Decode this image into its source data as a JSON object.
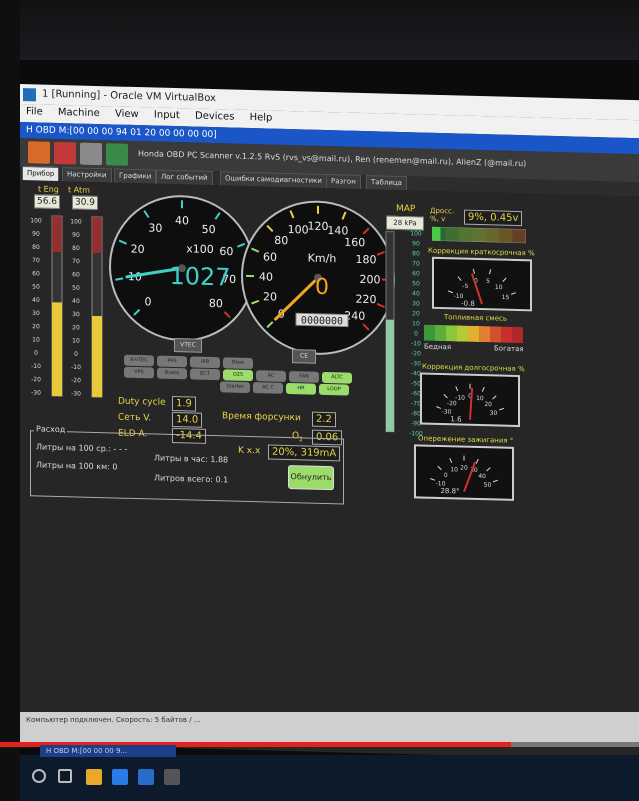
{
  "vm": {
    "title": "1 [Running] - Oracle VM VirtualBox",
    "menu": [
      "File",
      "Machine",
      "View",
      "Input",
      "Devices",
      "Help"
    ],
    "guest_window_title": "H OBD M:[00 00 00 94 01 20 00 00 00 00]"
  },
  "app": {
    "title": "Honda OBD PC Scanner v.1.2.5  RvS (rvs_vs@mail.ru), Ren (renemen@mail.ru), AlienZ (@mail.ru)",
    "tabs": [
      "Прибор",
      "Настройки",
      "Графики",
      "Лог событий",
      "Ошибки самодиагностики",
      "Разгон",
      "Таблица"
    ],
    "active_tab": 0
  },
  "bars": {
    "eng_label": "t Eng",
    "atm_label": "t Atm",
    "eng_value": "56.6",
    "atm_value": "30.9",
    "ticks": [
      "100",
      "90",
      "80",
      "70",
      "60",
      "50",
      "40",
      "30",
      "20",
      "10",
      "0",
      "-10",
      "-20",
      "-30"
    ],
    "eng_level": 0.52,
    "atm_level": 0.45
  },
  "tach": {
    "unit": "x100",
    "value": "1027",
    "ticks": [
      "0",
      "10",
      "20",
      "30",
      "40",
      "50",
      "60",
      "70",
      "80"
    ],
    "needle_value": 10.27,
    "max": 80,
    "gear_box": "VTEC"
  },
  "speedo": {
    "unit": "Km/h",
    "value": "0",
    "ticks": [
      "0",
      "20",
      "40",
      "60",
      "80",
      "100",
      "120",
      "140",
      "160",
      "180",
      "200",
      "220",
      "240"
    ],
    "odometer": "0000000",
    "needle_value": 0,
    "max": 240,
    "box": "CE"
  },
  "indicators": {
    "items": [
      {
        "label": "K-VTEC",
        "on": false
      },
      {
        "label": "PAS",
        "on": false
      },
      {
        "label": "IAB",
        "on": false
      },
      {
        "label": "Blow",
        "on": false
      },
      {
        "label": "VPS",
        "on": false
      },
      {
        "label": "Brake",
        "on": false
      },
      {
        "label": "ECT",
        "on": false
      },
      {
        "label": "O2S",
        "on": true
      },
      {
        "label": "AC",
        "on": false
      },
      {
        "label": "FAN",
        "on": false
      },
      {
        "label": "ALTC",
        "on": true
      },
      {
        "label": "Starter",
        "on": false
      },
      {
        "label": "AC C",
        "on": false
      },
      {
        "label": "HR",
        "on": true
      },
      {
        "label": "LOOP",
        "on": true
      }
    ]
  },
  "readouts": {
    "duty_cycle_label": "Duty cycle",
    "duty_cycle": "1.9",
    "set_v_label": "Сеть V.",
    "set_v": "14.0",
    "eld_label": "ELD  A.",
    "eld": "-14.4",
    "injector_label": "Время  форсунки",
    "injector": "2.2",
    "o2_label": "O",
    "o2_sub": "2",
    "o2": "0.06",
    "kxx_label": "K x.x",
    "kxx": "20%, 319mA"
  },
  "consumption": {
    "title": "Расход",
    "l100_avg": "Литры на 100 ср.: - - -",
    "l100_km": "Литры на 100 км: 0",
    "l_hour": "Литры в час: 1.88",
    "l_total": "Литров всего: 0.1",
    "reset": "Обнулить"
  },
  "map": {
    "label": "MAP",
    "value": "28 kPa",
    "ticks": [
      "100",
      "90",
      "80",
      "70",
      "60",
      "50",
      "40",
      "30",
      "20",
      "10",
      "0",
      "-10",
      "-20",
      "-30",
      "-40",
      "-50",
      "-60",
      "-70",
      "-80",
      "-90",
      "-100"
    ],
    "level": 0.12
  },
  "throttle": {
    "label": "Дросс.",
    "sub": "%, v",
    "value": "9%, 0.45v",
    "level": 0.09
  },
  "short_trim": {
    "title": "Коррекция краткосрочная %",
    "ticks": [
      "-10",
      "-5",
      "0",
      "5",
      "10",
      "15"
    ],
    "value": "-0.8",
    "reading": -0.8
  },
  "fuel_mix": {
    "title": "Топливная смесь",
    "lean": "Бедная",
    "rich": "Богатая"
  },
  "long_trim": {
    "title": "Коррекция долгосрочная %",
    "ticks": [
      "-30",
      "-20",
      "-10",
      "0",
      "10",
      "20",
      "30"
    ],
    "value": "1.6",
    "reading": 1.6
  },
  "ignition": {
    "title": "Опережение зажигания °",
    "ticks": [
      "-10",
      "0",
      "10",
      "20",
      "30",
      "40",
      "50"
    ],
    "value": "28.8°",
    "reading": 28.8
  },
  "status": {
    "text": "Компьютер подключен. Скорость: 5 байтов / ...",
    "task_title": "H OBD M:[00 00 00 9..."
  },
  "video": {
    "progress": 0.8
  },
  "colors": {
    "gauge_needle": "#f2a621",
    "tach_needle": "#3fd0c8",
    "digital": "#3fd0c8",
    "accent_yellow": "#e8d34a",
    "green": "#9bdc6a",
    "red": "#d23030",
    "progress": "#e52020"
  }
}
